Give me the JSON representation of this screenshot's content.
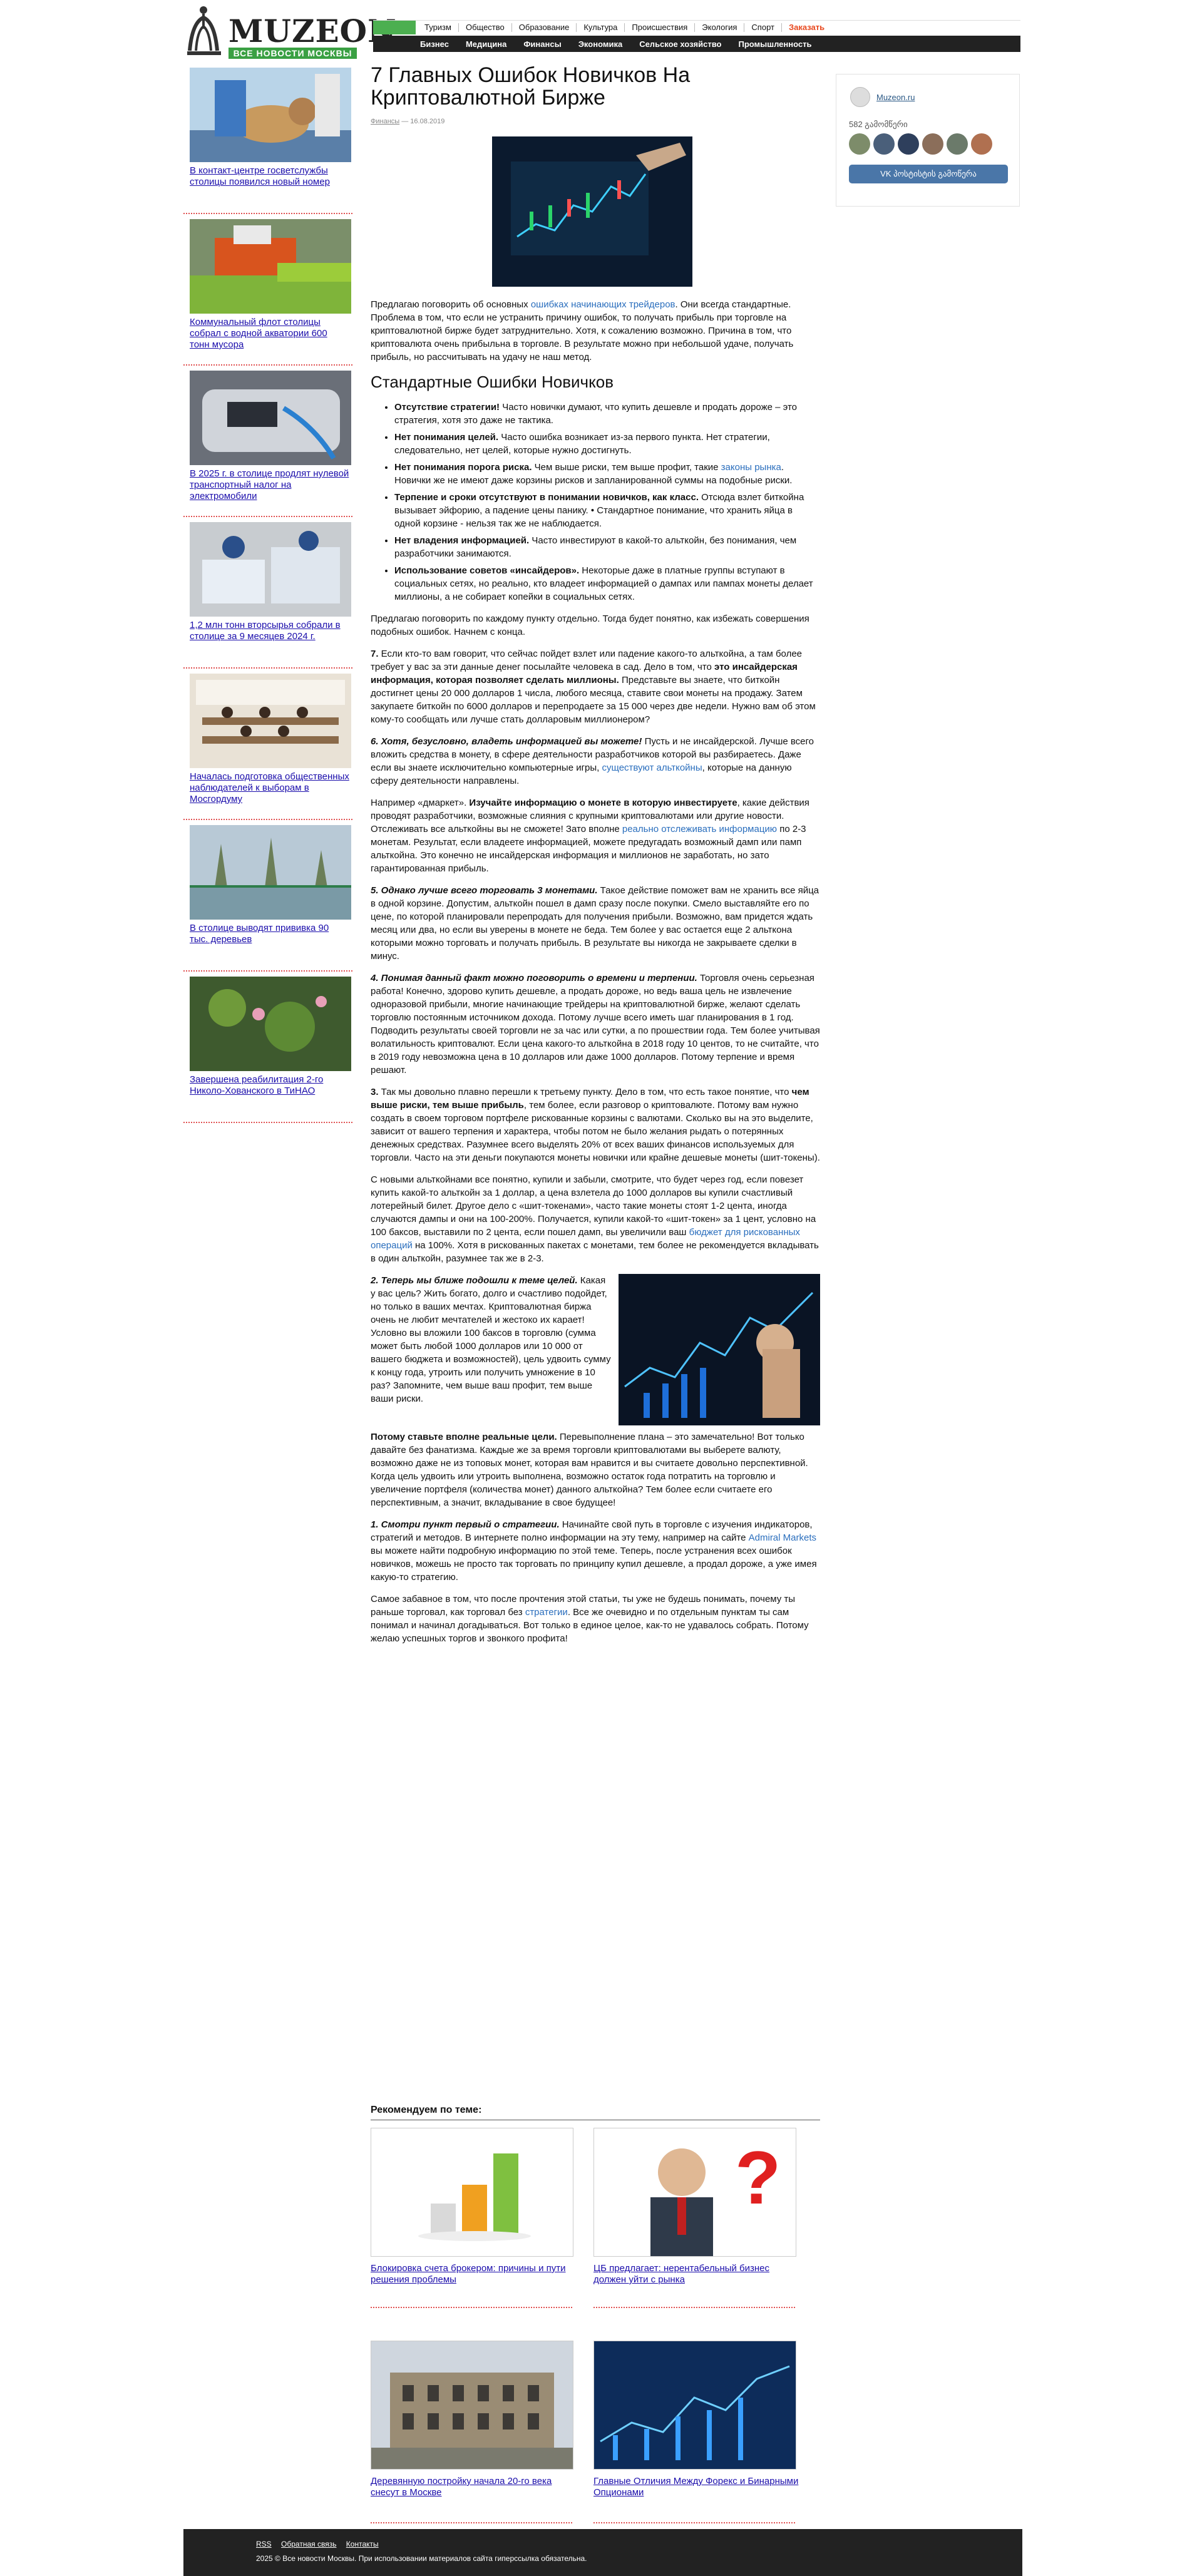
{
  "header": {
    "logo_text": "MUZEON",
    "logo_tagline": "ВСЕ НОВОСТИ МОСКВЫ",
    "top_nav": [
      "Туризм",
      "Общество",
      "Образование",
      "Культура",
      "Происшествия",
      "Экология",
      "Спорт"
    ],
    "top_nav_highlight": "Заказать",
    "sub_nav": [
      "Бизнес",
      "Медицина",
      "Финансы",
      "Экономика",
      "Сельское хозяйство",
      "Промышленность"
    ]
  },
  "sidebar": {
    "items": [
      {
        "title": "В контакт-центре госветслужбы столицы появился новый номер",
        "icon": "dog-vet-photo"
      },
      {
        "title": "Коммунальный флот столицы собрал с водной акватории 600 тонн мусора",
        "icon": "boat-photo"
      },
      {
        "title": "В 2025 г. в столице продлят нулевой транспортный налог на электромобили",
        "icon": "ev-charging-photo"
      },
      {
        "title": "1,2 млн тонн вторсырья собрали в столице за 9 месяцев 2024 г.",
        "icon": "recycling-photo"
      },
      {
        "title": "Началась подготовка общественных наблюдателей к выборам в Мосгордуму",
        "icon": "classroom-photo"
      },
      {
        "title": "В столице выводят прививка 90 тыс. деревьев",
        "icon": "park-photo"
      },
      {
        "title": "Завершена реабилитация 2-го Николо-Хованского в ТиНАО",
        "icon": "pond-photo"
      }
    ]
  },
  "article": {
    "title": "7 Главных Ошибок Новичков На Криптовалютной Бирже",
    "meta_author": "Финансы",
    "meta_date": "— 16.08.2019",
    "intro_pre": "Предлагаю поговорить об основных ",
    "intro_link": "ошибках начинающих трейдеров",
    "intro_post": ". Они всегда стандартные. Проблема в том, что если не устранить причину ошибок, то получать прибыль при торговле на криптовалютной бирже будет затруднительно. Хотя, к сожалению возможно. Причина в том, что криптовалюта очень прибыльна в торговле. В результате можно при небольшой удаче, получать прибыль, но рассчитывать на удачу не наш метод.",
    "h2": "Стандартные Ошибки Новичков",
    "bullets": [
      {
        "bold": "Отсутствие стратегии!",
        "text": " Часто новички думают, что купить дешевле и продать дороже – это стратегия, хотя это даже не тактика."
      },
      {
        "bold": "Нет понимания целей.",
        "text": " Часто ошибка возникает из-за первого пункта. Нет стратегии, следовательно, нет целей, которые нужно достигнуть."
      },
      {
        "bold": "Нет понимания порога риска.",
        "text": " Чем выше риски, тем выше профит, такие ",
        "link": "законы рынка",
        "after": ". Новички же не имеют даже корзины рисков и запланированной суммы на подобные риски."
      },
      {
        "bold": "Терпение и сроки отсутствуют в понимании новичков, как класс.",
        "text": " Отсюда взлет биткойна вызывает эйфорию, а падение цены панику. • Стандартное понимание, что хранить яйца в одной корзине - нельзя так же не наблюдается."
      },
      {
        "bold": "Нет владения информацией.",
        "text": " Часто инвестируют в какой-то альткойн, без понимания, чем разработчики занимаются."
      },
      {
        "bold": "Использование советов «инсайдеров».",
        "text": " Некоторые даже в платные группы вступают в социальных сетях, но реально, кто владеет информацией о дампах или пампах монеты делает миллионы, а не собирает копейки в социальных сетях."
      }
    ],
    "p_after_list": "Предлагаю поговорить по каждому пункту отдельно. Тогда будет понятно, как избежать совершения подобных ошибок. Начнем с конца.",
    "p7_num": "7.",
    "p7_a": " Если кто-то вам говорит, что сейчас пойдет взлет или падение какого-то альткойна, а там более требует у вас за эти данные денег посылайте человека в сад. Дело в том, что ",
    "p7_bold": "это инсайдерская информация, которая позволяет сделать миллионы.",
    "p7_b": " Представьте вы знаете, что биткойн достигнет цены 20 000 долларов 1 числа, любого месяца, ставите свои монеты на продажу. Затем закупаете биткойн по 6000 долларов и перепродаете за 15 000 через две недели. Нужно вам об этом кому-то сообщать или лучше стать долларовым миллионером?",
    "p6_bold": "6. Хотя, безусловно, владеть информацией вы можете!",
    "p6_a": " Пусть и не инсайдерской. Лучше всего вложить средства в монету, в сфере деятельности разработчиков которой вы разбираетесь. Даже если вы знаете исключительно компьютерные игры, ",
    "p6_link": "существуют альткойны",
    "p6_b": ", которые на данную сферу деятельности направлены.",
    "p6b_a": "Например «дмаркет». ",
    "p6b_bold": "Изучайте информацию о монете в которую инвестируете",
    "p6b_b": ", какие действия проводят разработчики, возможные слияния с крупными криптовалютами или другие новости. Отслеживать все альткойны вы не сможете! Зато вполне ",
    "p6b_link": "реально отслеживать информацию",
    "p6b_c": " по 2-3 монетам. Результат, если владеете информацией, можете предугадать возможный дамп или памп альткойна. Это конечно не инсайдерская информация и миллионов не заработать, но зато гарантированная прибыль.",
    "p5_bold": "5. Однако лучше всего торговать 3 монетами.",
    "p5_text": " Такое действие поможет вам не хранить все яйца в одной корзине. Допустим, альткойн пошел в дамп сразу после покупки. Смело выставляйте его по цене, по которой планировали перепродать для получения прибыли. Возможно, вам придется ждать месяц или два, но если вы уверены в монете не беда. Тем более у вас остается еще 2 альткона которыми можно торговать и получать прибыль. В результате вы никогда не закрываете сделки в минус.",
    "p4_bold": "4. Понимая данный факт можно поговорить о времени и терпении.",
    "p4_text": " Торговля очень серьезная работа! Конечно, здорово купить дешевле, а продать дороже, но ведь ваша цель не извлечение одноразовой прибыли, многие начинающие трейдеры на криптовалютной бирже, желают сделать торговлю постоянным источником дохода. Потому лучше всего иметь шаг планирования в 1 год. Подводить результаты своей торговли не за час или сутки, а по прошествии года. Тем более учитывая волатильность криптовалют. Если цена какого-то альткойна в 2018 году 10 центов, то не считайте, что в 2019 году невозможна цена в 10 долларов или даже 1000 долларов. Потому терпение и время решают.",
    "p3_num": "3.",
    "p3_a": " Так мы довольно плавно перешли к третьему пункту. Дело в том, что есть такое понятие, что ",
    "p3_bold": "чем выше риски, тем выше прибыль",
    "p3_b": ", тем более, если разговор о криптовалюте. Потому вам нужно создать в своем торговом портфеле рискованные корзины с валютами. Сколько вы на это выделите, зависит от вашего терпения и характера, чтобы потом не было желания рыдать о потерянных денежных средствах. Разумнее всего выделять 20% от всех ваших финансов используемых для торговли. Часто на эти деньги покупаются монеты новички или крайне дешевые монеты (шит-токены).",
    "p3b_a": "С новыми альткойнами все понятно, купили и забыли, смотрите, что будет через год, если повезет купить какой-то альткойн за 1 доллар, а цена взлетела до 1000 долларов вы купили счастливый лотерейный билет. Другое дело с «шит-токенами», часто такие монеты стоят 1-2 цента, иногда случаются дампы и они на 100-200%. Получается, купили какой-то «шит-токен» за 1 цент, условно на 100 баксов, выставили по 2 цента, если пошел дамп, вы увеличили ваш ",
    "p3b_link": "бюджет для рискованных операций",
    "p3b_b": " на 100%. Хотя в рискованных пакетах с монетами, тем более не рекомендуется вкладывать в один альткойн, разумнее так же в 2-3.",
    "p2_bold": "2. Теперь мы ближе подошли к теме целей.",
    "p2_text": " Какая у вас цель? Жить богато, долго и счастливо подойдет, но только в ваших мечтах. Криптовалютная биржа очень не любит мечтателей и жестоко их карает! Условно вы вложили 100 баксов в торговлю (сумма может быть любой 1000 долларов или 10 000 от вашего бюджета и возможностей), цель удвоить сумму к концу года, утроить или получить умножение в 10 раз? Запомните, чем выше ваш профит, тем выше ваши риски.",
    "p2b_bold": "Потому ставьте вполне реальные цели.",
    "p2b_text": " Перевыполнение плана – это замечательно! Вот только давайте без фанатизма. Каждые же за время торговли криптовалютами вы выберете валюту, возможно даже не из топовых монет, которая вам нравится и вы считаете довольно перспективной. Когда цель удвоить или утроить выполнена, возможно остаток года потратить на торговлю и увеличение портфеля (количества монет) данного альткойна? Тем более если считаете его перспективным, а значит, вкладывание в свое будущее!",
    "p1_bold": "1. Смотри пункт первый о стратегии.",
    "p1_a": " Начинайте свой путь в торговле с изучения индикаторов, стратегий и методов. В интернете полно информации на эту тему, например на сайте ",
    "p1_link": "Admiral Markets",
    "p1_b": " вы можете найти подробную информацию по этой теме. Теперь, после устранения всех ошибок новичков, можешь не просто так торговать по принципу купил дешевле, а продал дороже, а уже имея какую-то стратегию.",
    "p_end_a": "Самое забавное в том, что после прочтения этой статьи, ты уже не будешь понимать, почему ты раньше торговал, как торговал без ",
    "p_end_link": "стратегии",
    "p_end_b": ". Все же очевидно и по отдельным пунктам ты сам понимал и начинал догадываться. Вот только в единое целое, как-то не удавалось собрать. Потому желаю успешных торгов и звонкого профита!"
  },
  "widget": {
    "name": "Muzeon.ru",
    "count": "582 გამომწერი",
    "button": "VK  პოსტისტის გამოწერა",
    "faces": [
      "#7d8c6a",
      "#4a5f7a",
      "#2e3f5c",
      "#8b6e5a",
      "#6b7a6a",
      "#b07050"
    ]
  },
  "recommended": {
    "title": "Рекомендуем по теме:",
    "items": [
      {
        "title": "Блокировка счета брокером: причины и пути решения проблемы",
        "icon": "bar-chart-3d-image"
      },
      {
        "title": "ЦБ предлагает: нерентабельный бизнес должен уйти с рынка",
        "icon": "question-man-image"
      },
      {
        "title": "Деревянную постройку начала 20-го века снесут в Москве",
        "icon": "building-image"
      },
      {
        "title": "Главные Отличия Между Форекс и Бинарными Опционами",
        "icon": "forex-chart-image"
      }
    ]
  },
  "footer": {
    "links": [
      "RSS",
      "Обратная связь",
      "Контакты"
    ],
    "copy": "2025 © Все новости Москвы. При использовании материалов сайта гиперссылка обязательна."
  }
}
